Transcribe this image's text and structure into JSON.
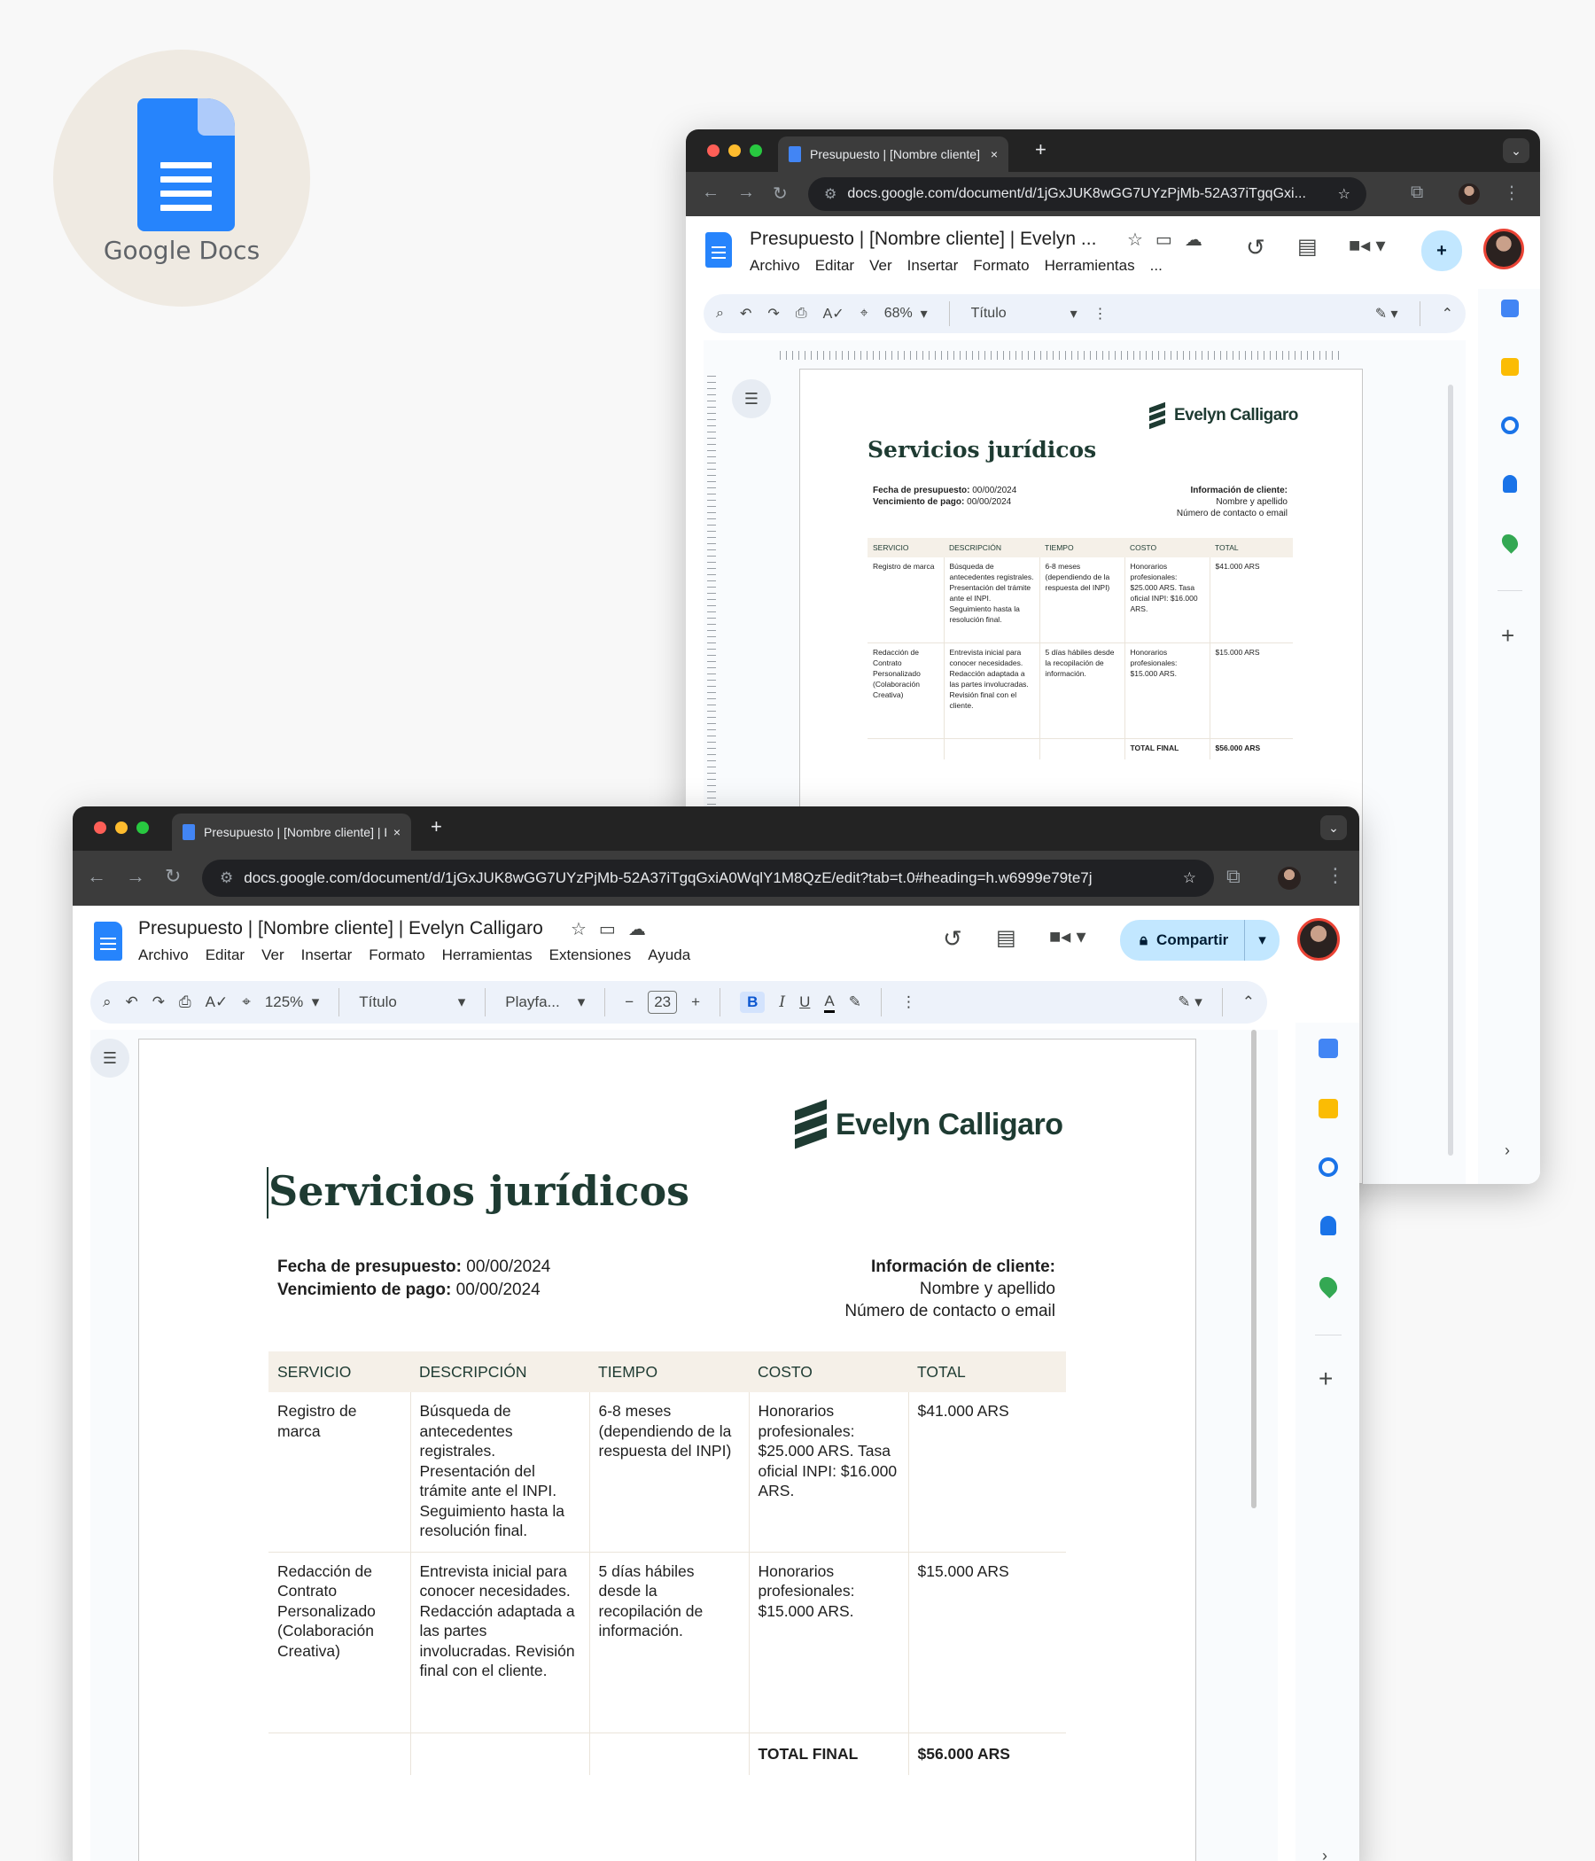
{
  "logo": {
    "brand": "Google Docs"
  },
  "browser": {
    "tab_title": "Presupuesto | [Nombre cliente] | Evelyn Calligaro",
    "url_back": "docs.google.com/document/d/1jGxJUK8wGG7UYzPjMb-52A37iTgqGxi...",
    "url_front": "docs.google.com/document/d/1jGxJUK8wGG7UYzPjMb-52A37iTgqGxiA0WqlY1M8QzE/edit?tab=t.0#heading=h.w6999e79te7j",
    "new_tab": "+",
    "close": "×"
  },
  "docs": {
    "title_back": "Presupuesto | [Nombre cliente] | Evelyn ...",
    "title_front": "Presupuesto | [Nombre cliente] | Evelyn Calligaro",
    "menu_back": [
      "Archivo",
      "Editar",
      "Ver",
      "Insertar",
      "Formato",
      "Herramientas",
      "..."
    ],
    "menu_front": [
      "Archivo",
      "Editar",
      "Ver",
      "Insertar",
      "Formato",
      "Herramientas",
      "Extensiones",
      "Ayuda"
    ],
    "share_label": "Compartir",
    "zoom_back": "68%",
    "zoom_front": "125%",
    "style": "Título",
    "font": "Playfa...",
    "font_size": "23",
    "bold": "B",
    "italic": "I",
    "underline": "U",
    "textcolor": "A"
  },
  "document": {
    "brand": "Evelyn Calligaro",
    "heading": "Servicios jurídicos",
    "fecha_label": "Fecha de presupuesto:",
    "fecha_value": " 00/00/2024",
    "venc_label": "Vencimiento de pago:",
    "venc_value": " 00/00/2024",
    "client_title": "Información de cliente:",
    "client_name": "Nombre y apellido",
    "client_contact": "Número de contacto o email",
    "table": {
      "headers": [
        "SERVICIO",
        "DESCRIPCIÓN",
        "TIEMPO",
        "COSTO",
        "TOTAL"
      ],
      "rows": [
        [
          "Registro de marca",
          "Búsqueda de antecedentes registrales. Presentación del trámite ante el INPI. Seguimiento hasta la resolución final.",
          "6-8 meses (dependiendo de la respuesta del INPI)",
          "Honorarios profesionales: $25.000 ARS. Tasa oficial INPI: $16.000 ARS.",
          "$41.000 ARS"
        ],
        [
          "Redacción de Contrato Personalizado (Colaboración Creativa)",
          "Entrevista inicial para conocer necesidades. Redacción adaptada a las partes involucradas. Revisión final con el cliente.",
          "5 días hábiles desde la recopilación de información.",
          "Honorarios profesionales: $15.000 ARS.",
          "$15.000 ARS"
        ]
      ],
      "total_label": "TOTAL FINAL",
      "total_value": "$56.000 ARS"
    }
  },
  "colors": {
    "accent": "#1e3b32",
    "header_bg": "#f5f0e8",
    "docs_blue": "#2684fc",
    "share_bg": "#c2e7ff"
  }
}
